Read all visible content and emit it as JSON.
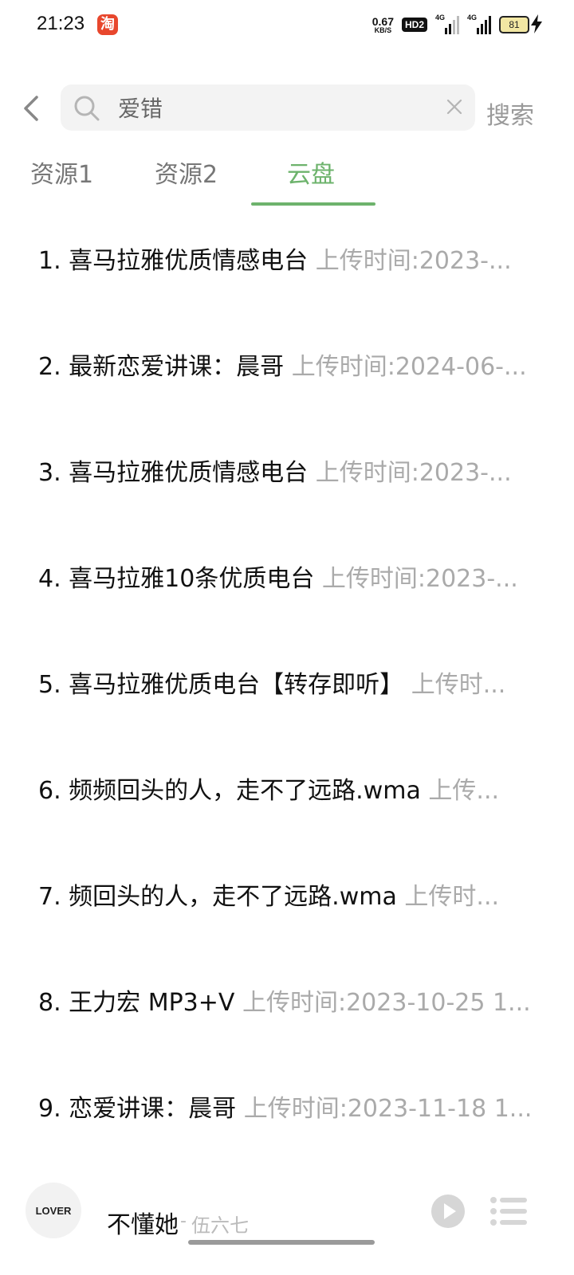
{
  "status_bar": {
    "time": "21:23",
    "taobao_badge": "淘",
    "net_speed_value": "0.67",
    "net_speed_unit": "KB/S",
    "hd_label": "HD2",
    "signal1_label": "4G",
    "signal2_label": "4G",
    "battery_level": "81"
  },
  "search": {
    "query": "爱错",
    "button_label": "搜索"
  },
  "tabs": [
    {
      "label": "资源1",
      "active": false
    },
    {
      "label": "资源2",
      "active": false
    },
    {
      "label": "云盘",
      "active": true
    }
  ],
  "results": [
    {
      "num": "1.",
      "title": "喜马拉雅优质情感电台",
      "meta": "上传时间:2023-..."
    },
    {
      "num": "2.",
      "title": "最新恋爱讲课：晨哥",
      "meta": "上传时间:2024-06-..."
    },
    {
      "num": "3.",
      "title": "喜马拉雅优质情感电台",
      "meta": "上传时间:2023-..."
    },
    {
      "num": "4.",
      "title": "喜马拉雅10条优质电台",
      "meta": "上传时间:2023-..."
    },
    {
      "num": "5.",
      "title": "喜马拉雅优质电台【转存即听】",
      "meta": "上传时..."
    },
    {
      "num": "6.",
      "title": "频频回头的人，走不了远路.wma",
      "meta": "上传..."
    },
    {
      "num": "7.",
      "title": "频回头的人，走不了远路.wma",
      "meta": "上传时..."
    },
    {
      "num": "8.",
      "title": "王力宏 MP3+V",
      "meta": "上传时间:2023-10-25 1..."
    },
    {
      "num": "9.",
      "title": "恋爱讲课：晨哥",
      "meta": "上传时间:2023-11-18 1..."
    }
  ],
  "player": {
    "album_text": "LOVER",
    "song_title": "不懂她",
    "separator": "-",
    "artist": "伍六七"
  },
  "colors": {
    "accent_green": "#6db36c",
    "meta_gray": "#aaaaaa"
  }
}
